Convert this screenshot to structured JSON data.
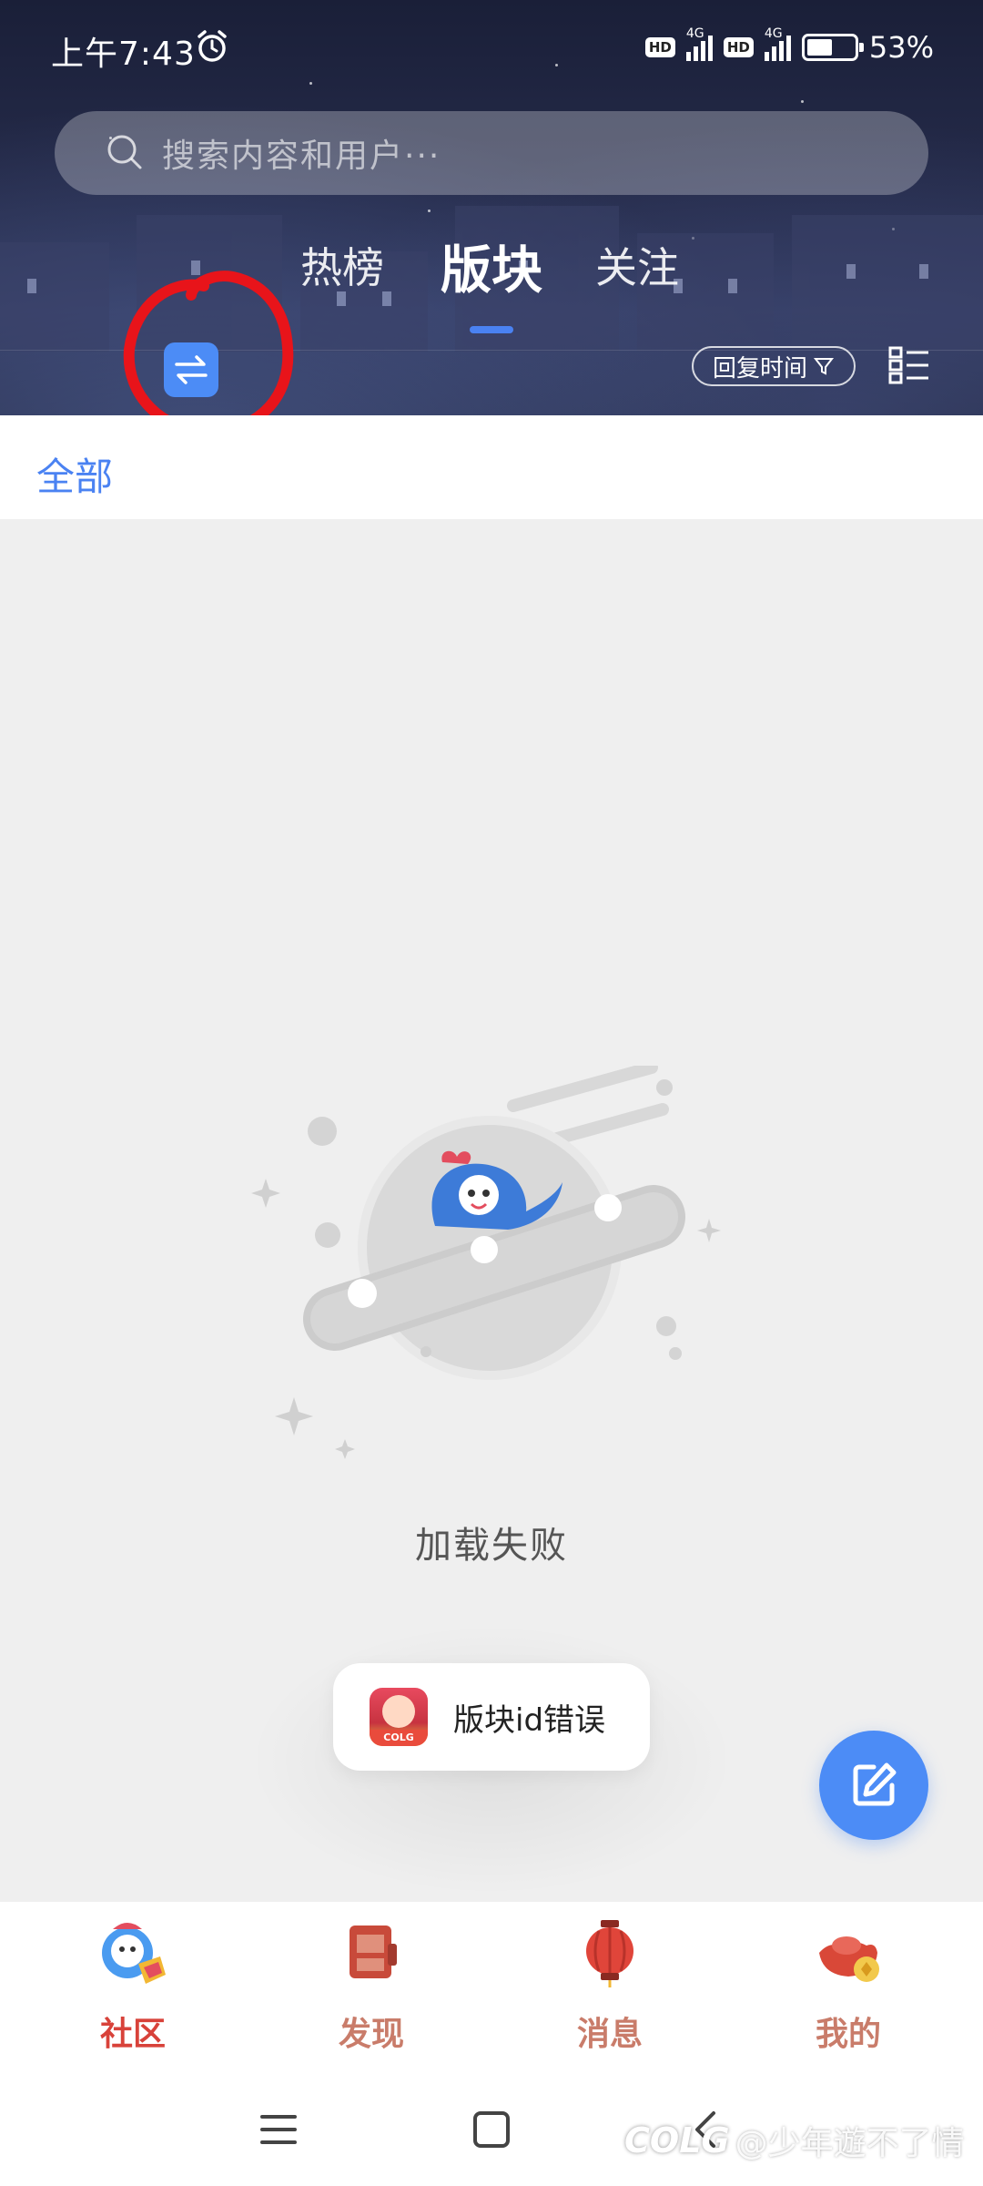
{
  "status_bar": {
    "time": "上午7:43",
    "hd_label": "HD",
    "network_label": "4G",
    "battery_percent": "53%",
    "battery_level": 0.53
  },
  "search": {
    "placeholder": "搜索内容和用户···"
  },
  "tabs": [
    {
      "label": "热榜",
      "active": false
    },
    {
      "label": "版块",
      "active": true
    },
    {
      "label": "关注",
      "active": false
    }
  ],
  "toolbar": {
    "swap_icon": "swap-arrows-icon",
    "sort_label": "回复时间",
    "sort_icon": "filter-icon",
    "view_icon": "list-view-icon"
  },
  "category": {
    "selected": "全部"
  },
  "empty_state": {
    "message": "加载失败"
  },
  "toast": {
    "message": "版块id错误",
    "app_icon_text": "COLG"
  },
  "fab": {
    "icon": "edit-icon"
  },
  "bottom_nav": [
    {
      "label": "社区",
      "icon": "community-mascot-icon",
      "active": true
    },
    {
      "label": "发现",
      "icon": "discover-icon",
      "active": false
    },
    {
      "label": "消息",
      "icon": "lantern-icon",
      "active": false
    },
    {
      "label": "我的",
      "icon": "gold-ingot-icon",
      "active": false
    }
  ],
  "watermark": {
    "logo": "COLG",
    "text": "@少年遊不了情"
  },
  "colors": {
    "accent": "#4c8cf6",
    "tab_indicator": "#4a82f2",
    "nav_active": "#d8423a",
    "nav_inactive": "#c97c6a",
    "annotation_red": "#e8141a"
  }
}
